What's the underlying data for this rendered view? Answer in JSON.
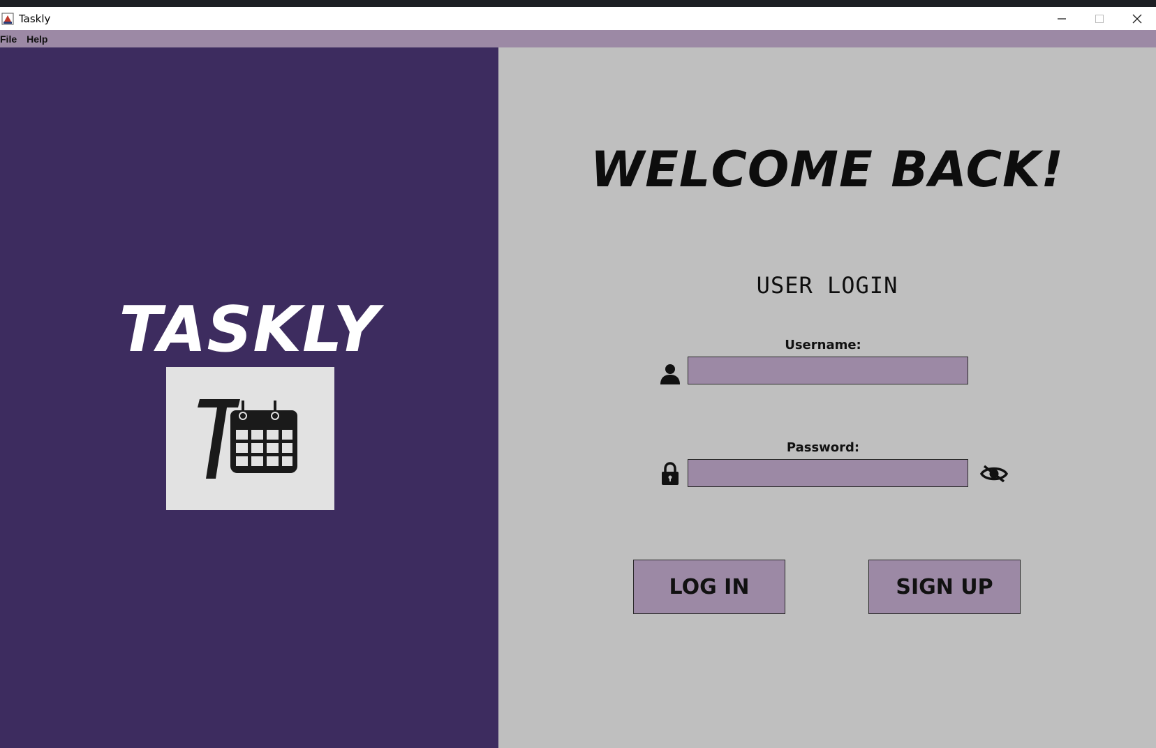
{
  "window": {
    "title": "Taskly"
  },
  "menubar": {
    "items": [
      "File",
      "Help"
    ]
  },
  "brand": {
    "name": "TASKLY"
  },
  "login": {
    "welcome": "WELCOME BACK!",
    "title": "USER LOGIN",
    "username_label": "Username:",
    "username_value": "",
    "password_label": "Password:",
    "password_value": "",
    "login_button": "LOG IN",
    "signup_button": "SIGN UP"
  },
  "icons": {
    "user": "person-icon",
    "password": "lock-icon",
    "visibility": "eye-slash-icon",
    "logo": "calendar-icon"
  },
  "colors": {
    "sidebar": "#3d2c5f",
    "accent": "#9c89a5",
    "background": "#bfbfbf",
    "logo_bg": "#e2e2e2"
  }
}
